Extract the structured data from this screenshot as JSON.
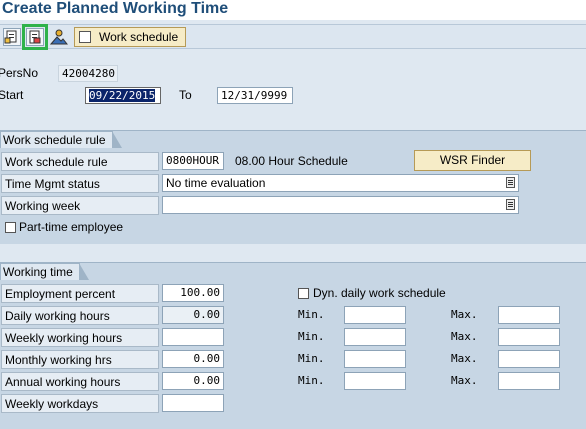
{
  "title": "Create Planned Working Time",
  "toolbar": {
    "buttons": [
      "overview-icon",
      "save-icon",
      "picture-icon"
    ],
    "work_schedule_label": "Work schedule"
  },
  "header": {
    "persno_label": "PersNo",
    "persno_value": "42004280",
    "start_label": "Start",
    "start_value": "09/22/2015",
    "to_label": "To",
    "to_value": "12/31/9999"
  },
  "wsr_group": {
    "tab": "Work schedule rule",
    "rule_label": "Work schedule rule",
    "rule_value": "0800HOUR",
    "rule_text": "08.00 Hour Schedule",
    "wsr_finder": "WSR Finder",
    "tm_status_label": "Time Mgmt status",
    "tm_status_value": "No time evaluation",
    "working_week_label": "Working week",
    "working_week_value": "",
    "part_time_label": "Part-time employee"
  },
  "wt_group": {
    "tab": "Working time",
    "employment_percent_label": "Employment percent",
    "employment_percent_value": "100.00",
    "dyn_label": "Dyn. daily work schedule",
    "daily_label": "Daily working hours",
    "daily_value": "0.00",
    "weekly_label": "Weekly working hours",
    "weekly_value": "",
    "monthly_label": "Monthly working hrs",
    "monthly_value": "0.00",
    "annual_label": "Annual working hours",
    "annual_value": "0.00",
    "workdays_label": "Weekly workdays",
    "workdays_value": "",
    "min_label": "Min.",
    "max_label": "Max."
  },
  "colors": {
    "title": "#1f4e79",
    "background": "#dfe8f1",
    "group_bg": "#c7d6e4",
    "button_bg": "#f6ecc7",
    "selection_outline": "#2fb24a"
  }
}
